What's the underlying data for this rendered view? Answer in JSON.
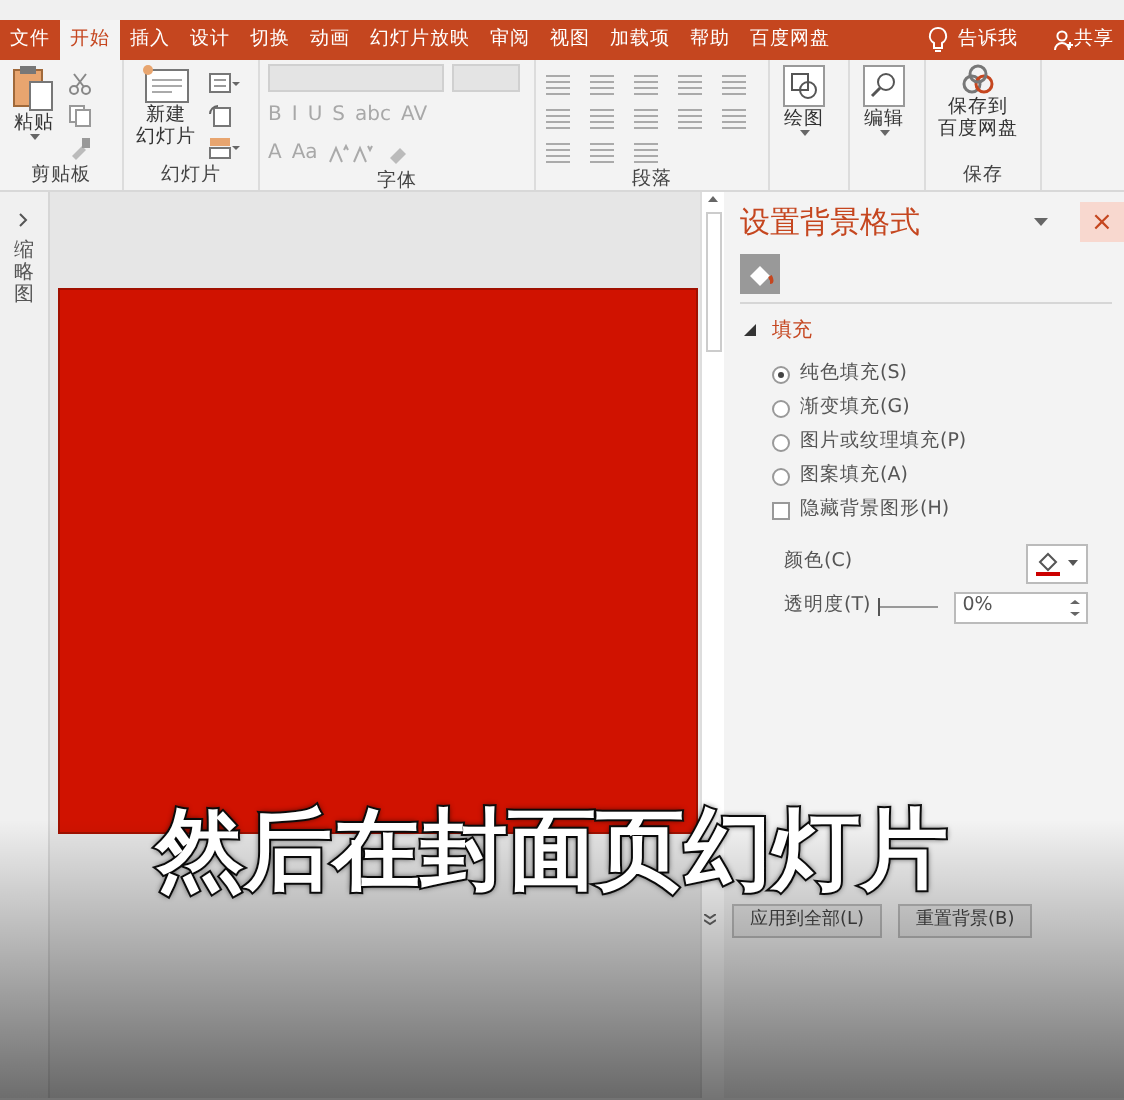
{
  "ribbon_tabs": [
    {
      "label": "文件",
      "selected": false
    },
    {
      "label": "开始",
      "selected": true
    },
    {
      "label": "插入",
      "selected": false
    },
    {
      "label": "设计",
      "selected": false
    },
    {
      "label": "切换",
      "selected": false
    },
    {
      "label": "动画",
      "selected": false
    },
    {
      "label": "幻灯片放映",
      "selected": false
    },
    {
      "label": "审阅",
      "selected": false
    },
    {
      "label": "视图",
      "selected": false
    },
    {
      "label": "加载项",
      "selected": false
    },
    {
      "label": "帮助",
      "selected": false
    },
    {
      "label": "百度网盘",
      "selected": false
    }
  ],
  "tell_me": "告诉我",
  "share": "共享",
  "ribbon_groups": [
    {
      "kind": "clipboard",
      "label": "剪贴板",
      "button": "粘贴"
    },
    {
      "kind": "slides",
      "label": "幻灯片",
      "button_lines": [
        "新建",
        "幻灯片"
      ]
    },
    {
      "kind": "font",
      "label": "字体",
      "disabled": true,
      "row_1": [
        "B",
        "I",
        "U",
        "S",
        "abc",
        "AV"
      ],
      "row_2": [
        "A",
        "Aa"
      ]
    },
    {
      "kind": "paragraph",
      "label": "段落"
    },
    {
      "kind": "drawing",
      "button": "绘图"
    },
    {
      "kind": "editing",
      "button": "编辑"
    },
    {
      "kind": "save",
      "label": "保存",
      "button_lines": [
        "保存到",
        "百度网盘"
      ]
    }
  ],
  "thumbnails": {
    "label": "缩略图",
    "expanded": false
  },
  "format_pane": {
    "title": "设置背景格式",
    "close": "×",
    "section": {
      "label": "填充",
      "expanded": true
    },
    "fill_options": [
      {
        "kind": "radio",
        "label": "纯色填充(S)",
        "selected": true
      },
      {
        "kind": "radio",
        "label": "渐变填充(G)",
        "selected": false
      },
      {
        "kind": "radio",
        "label": "图片或纹理填充(P)",
        "selected": false
      },
      {
        "kind": "radio",
        "label": "图案填充(A)",
        "selected": false
      },
      {
        "kind": "checkbox",
        "label": "隐藏背景图形(H)",
        "checked": false
      }
    ],
    "color_label": "颜色(C)",
    "transparency": {
      "label": "透明度(T)",
      "level": 0,
      "value": "0%"
    },
    "buttons": [
      "应用到全部(L)",
      "重置背景(B)"
    ]
  },
  "slide": {
    "color": "#d01200"
  },
  "subtitle": "然后在封面页幻灯片"
}
